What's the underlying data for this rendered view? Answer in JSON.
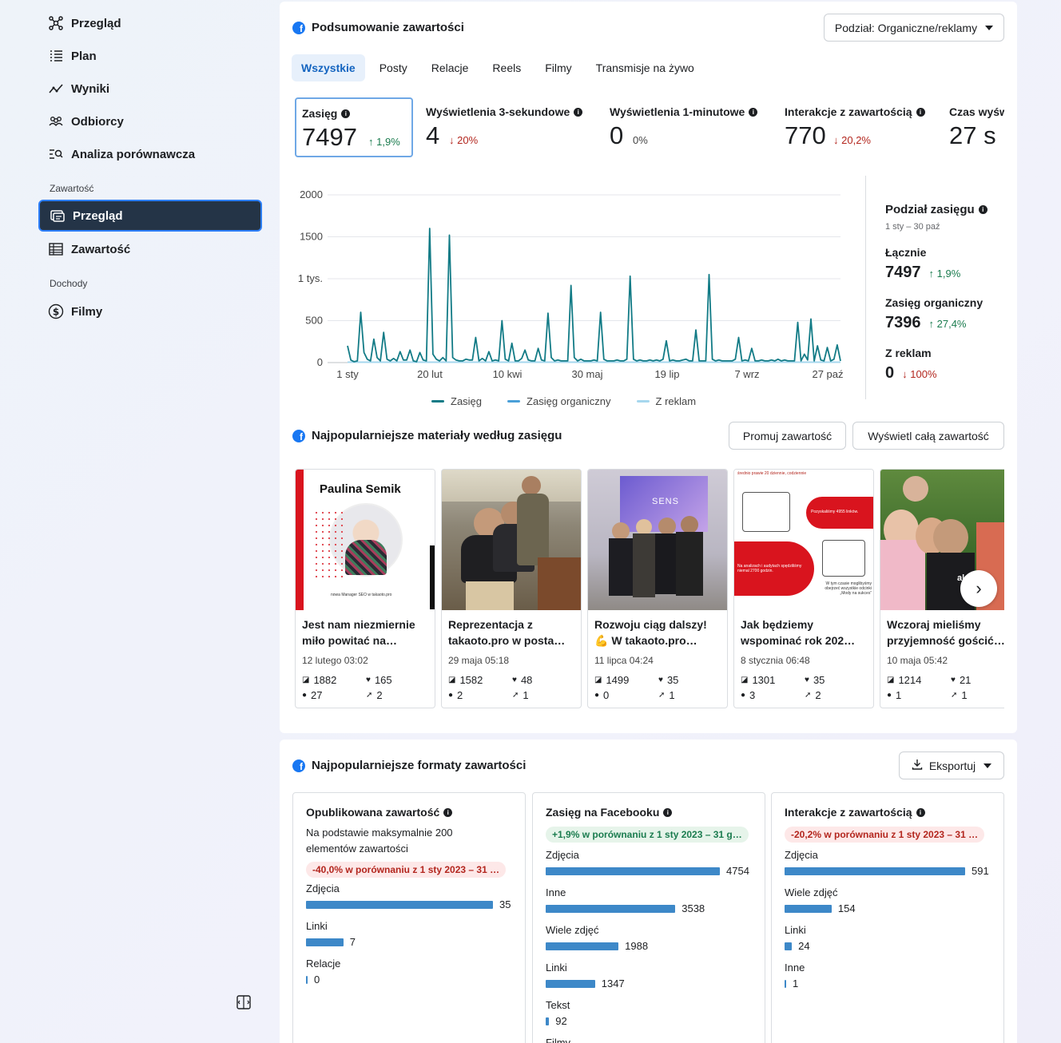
{
  "sidebar": {
    "items": [
      {
        "label": "Przegląd",
        "icon": "network-icon"
      },
      {
        "label": "Plan",
        "icon": "list-icon"
      },
      {
        "label": "Wyniki",
        "icon": "trend-icon"
      },
      {
        "label": "Odbiorcy",
        "icon": "people-icon"
      },
      {
        "label": "Analiza porównawcza",
        "icon": "compare-icon"
      }
    ],
    "section_content": "Zawartość",
    "content_items": [
      {
        "label": "Przegląd",
        "icon": "gallery-icon",
        "active": true
      },
      {
        "label": "Zawartość",
        "icon": "table-icon"
      }
    ],
    "section_income": "Dochody",
    "income_items": [
      {
        "label": "Filmy",
        "icon": "dollar-icon"
      }
    ]
  },
  "summary": {
    "title": "Podsumowanie zawartości",
    "split_dropdown": "Podział: Organiczne/reklamy",
    "tabs": [
      "Wszystkie",
      "Posty",
      "Relacje",
      "Reels",
      "Filmy",
      "Transmisje na żywo"
    ],
    "metrics": [
      {
        "label": "Zasięg",
        "value": "7497",
        "delta": "1,9%",
        "arrow": "↑"
      },
      {
        "label": "Wyświetlenia 3-sekundowe",
        "value": "4",
        "delta": "20%",
        "arrow": "↓"
      },
      {
        "label": "Wyświetlenia 1-minutowe",
        "value": "0",
        "delta": "0%",
        "arrow": ""
      },
      {
        "label": "Interakcje z zawartością",
        "value": "770",
        "delta": "20,2%",
        "arrow": "↓"
      },
      {
        "label": "Czas wyśw",
        "value": "27 s",
        "delta": "",
        "arrow": ""
      }
    ],
    "legend": [
      "Zasięg",
      "Zasięg organiczny",
      "Z reklam"
    ],
    "colors": {
      "reach": "#127b86",
      "organic": "#4a9fd8",
      "ads": "#a6d7ee"
    }
  },
  "chart_data": {
    "type": "line",
    "title": "",
    "xlabel": "",
    "ylabel": "",
    "y_ticks": [
      "2000",
      "1500",
      "1 tys.",
      "500",
      "0"
    ],
    "x_ticks": [
      "1 sty",
      "20 lut",
      "10 kwi",
      "30 maj",
      "19 lip",
      "7 wrz",
      "27 paź"
    ],
    "ylim": [
      0,
      2000
    ],
    "series": [
      {
        "name": "Zasięg",
        "x": [
          0,
          2,
          4,
          6,
          8,
          10,
          12,
          14,
          16,
          18,
          20,
          22,
          24,
          26,
          28,
          30,
          32,
          34,
          36,
          38,
          40,
          42,
          44,
          46,
          48,
          50,
          52,
          54,
          56,
          58,
          60,
          62,
          64,
          66,
          68,
          70,
          72,
          74,
          76,
          78,
          80,
          82,
          84,
          86,
          88,
          90,
          92,
          94,
          96,
          98,
          100,
          102,
          104,
          106,
          108,
          110,
          112,
          114,
          116,
          118,
          120,
          122,
          124,
          126,
          128,
          130,
          132,
          134,
          136,
          138,
          140,
          142,
          144,
          146,
          148,
          150,
          152,
          154,
          156,
          158,
          160,
          162,
          164,
          166,
          168,
          170,
          172,
          174,
          176,
          178,
          180,
          182,
          184,
          186,
          188,
          190,
          192,
          194,
          196,
          198,
          200,
          202,
          204,
          206,
          208,
          210,
          212,
          214,
          216,
          218,
          220,
          222,
          224,
          226,
          228,
          230,
          232,
          234,
          236,
          238,
          240,
          242,
          244,
          246,
          248,
          250,
          252,
          254,
          256,
          258,
          260,
          262,
          264,
          266,
          268,
          270,
          272,
          274,
          276,
          278,
          280,
          282,
          284,
          286,
          288,
          290,
          292,
          294,
          296,
          298,
          300
        ],
        "values": [
          200,
          30,
          10,
          20,
          600,
          120,
          40,
          20,
          280,
          60,
          20,
          360,
          40,
          20,
          50,
          20,
          130,
          30,
          30,
          150,
          20,
          10,
          120,
          30,
          20,
          1600,
          100,
          40,
          20,
          60,
          20,
          1520,
          60,
          30,
          20,
          20,
          40,
          30,
          30,
          300,
          20,
          50,
          20,
          130,
          20,
          30,
          20,
          500,
          40,
          20,
          230,
          20,
          20,
          50,
          150,
          30,
          20,
          20,
          170,
          30,
          20,
          590,
          60,
          20,
          30,
          20,
          20,
          20,
          920,
          60,
          20,
          40,
          20,
          20,
          20,
          30,
          20,
          600,
          40,
          20,
          20,
          20,
          30,
          20,
          20,
          40,
          1030,
          40,
          20,
          30,
          20,
          20,
          30,
          20,
          30,
          20,
          40,
          260,
          20,
          30,
          20,
          20,
          30,
          40,
          20,
          20,
          390,
          20,
          20,
          20,
          1050,
          40,
          20,
          30,
          20,
          20,
          20,
          20,
          40,
          300,
          20,
          30,
          20,
          170,
          20,
          20,
          30,
          20,
          20,
          30,
          20,
          40,
          20,
          30,
          20,
          20,
          20,
          480,
          20,
          100,
          30,
          520,
          20,
          200,
          30,
          20,
          180,
          20,
          40,
          210,
          20
        ]
      },
      {
        "name": "Zasięg organiczny",
        "values": []
      },
      {
        "name": "Z reklam",
        "values": [
          0,
          0,
          0,
          0,
          0,
          0,
          0
        ]
      }
    ]
  },
  "reach_split": {
    "title": "Podział zasięgu",
    "date_range": "1 sty – 30 paź",
    "total_label": "Łącznie",
    "total_value": "7497",
    "total_delta": "1,9%",
    "organic_label": "Zasięg organiczny",
    "organic_value": "7396",
    "organic_delta": "27,4%",
    "ads_label": "Z reklam",
    "ads_value": "0",
    "ads_delta": "100%"
  },
  "top_content": {
    "title": "Najpopularniejsze materiały według zasięgu",
    "promote_button": "Promuj zawartość",
    "view_all_button": "Wyświetl całą zawartość",
    "cards": [
      {
        "title": "Jest nam niezmiernie miło powitać na…",
        "date": "12 lutego 03:02",
        "reach": "1882",
        "likes": "165",
        "comments": "27",
        "shares": "2",
        "thumb_text": "Paulina Semik",
        "thumb_caption": "nowa Manager SEO w takaoto.pro"
      },
      {
        "title": "Reprezentacja z takaoto.pro w posta…",
        "date": "29 maja 05:18",
        "reach": "1582",
        "likes": "48",
        "comments": "2",
        "shares": "1"
      },
      {
        "title": "Rozwoju ciąg dalszy! 💪 W takaoto.pro…",
        "date": "11 lipca 04:24",
        "reach": "1499",
        "likes": "35",
        "comments": "0",
        "shares": "1",
        "thumb_text": "SENS"
      },
      {
        "title": "Jak będziemy wspominać rok 202…",
        "date": "8 stycznia 06:48",
        "reach": "1301",
        "likes": "35",
        "comments": "3",
        "shares": "2",
        "thumb_top": "średnio prawie 20 dziennie, codziennie",
        "thumb_mid": "Pozyskaliśmy 4955 linków.",
        "thumb_low": "Na analizach i audytach spędziliśmy niemal 2700 godzin.",
        "thumb_bottom": "W tym czasie moglibyśmy obejrzeć wszystkie odcinki „Mody na sukces”"
      },
      {
        "title": "Wczoraj mieliśmy przyjemność gościć…",
        "date": "10 maja 05:42",
        "reach": "1214",
        "likes": "21",
        "comments": "1",
        "shares": "1",
        "thumb_text": "akaoto"
      }
    ]
  },
  "formats": {
    "title": "Najpopularniejsze formaty zawartości",
    "export_button": "Eksportuj",
    "cards": [
      {
        "title": "Opublikowana zawartość",
        "desc": "Na podstawie maksymalnie 200 elementów zawartości",
        "pill": "-40,0% w porównaniu z 1 sty 2023 – 31 …",
        "pill_kind": "red",
        "bars": [
          {
            "label": "Zdjęcia",
            "value": 35
          },
          {
            "label": "Linki",
            "value": 7
          },
          {
            "label": "Relacje",
            "value": 0
          }
        ],
        "max": 35
      },
      {
        "title": "Zasięg na Facebooku",
        "desc": "",
        "pill": "+1,9% w porównaniu z 1 sty 2023 – 31 g…",
        "pill_kind": "green",
        "bars": [
          {
            "label": "Zdjęcia",
            "value": 4754
          },
          {
            "label": "Inne",
            "value": 3538
          },
          {
            "label": "Wiele zdjęć",
            "value": 1988
          },
          {
            "label": "Linki",
            "value": 1347
          },
          {
            "label": "Tekst",
            "value": 92
          },
          {
            "label": "Filmy",
            "value": null
          }
        ],
        "max": 4754
      },
      {
        "title": "Interakcje z zawartością",
        "desc": "",
        "pill": "-20,2% w porównaniu z 1 sty 2023 – 31 …",
        "pill_kind": "red",
        "bars": [
          {
            "label": "Zdjęcia",
            "value": 591
          },
          {
            "label": "Wiele zdjęć",
            "value": 154
          },
          {
            "label": "Linki",
            "value": 24
          },
          {
            "label": "Inne",
            "value": 1
          }
        ],
        "max": 591
      }
    ]
  }
}
